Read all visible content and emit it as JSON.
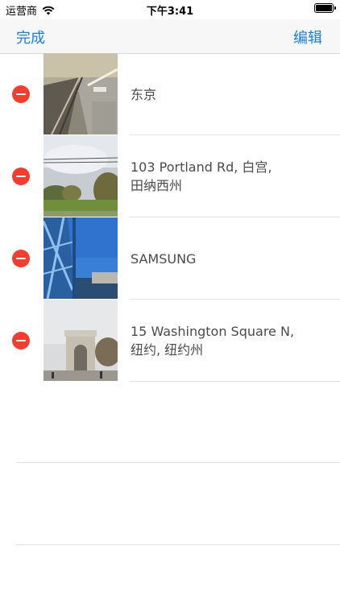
{
  "status_bar": {
    "carrier": "运营商",
    "time": "下午3:41",
    "wifi_icon": "wifi-icon",
    "battery_icon": "battery-icon"
  },
  "nav": {
    "done_label": "完成",
    "edit_label": "编辑"
  },
  "rows": [
    {
      "line1": "东京",
      "line2": ""
    },
    {
      "line1": "103 Portland Rd, 白宫,",
      "line2": "田纳西州"
    },
    {
      "line1": "SAMSUNG",
      "line2": ""
    },
    {
      "line1": "15 Washington Square N,",
      "line2": "纽约, 纽约州"
    }
  ],
  "colors": {
    "accent": "#1a7fe0",
    "delete": "#f23d2f"
  }
}
